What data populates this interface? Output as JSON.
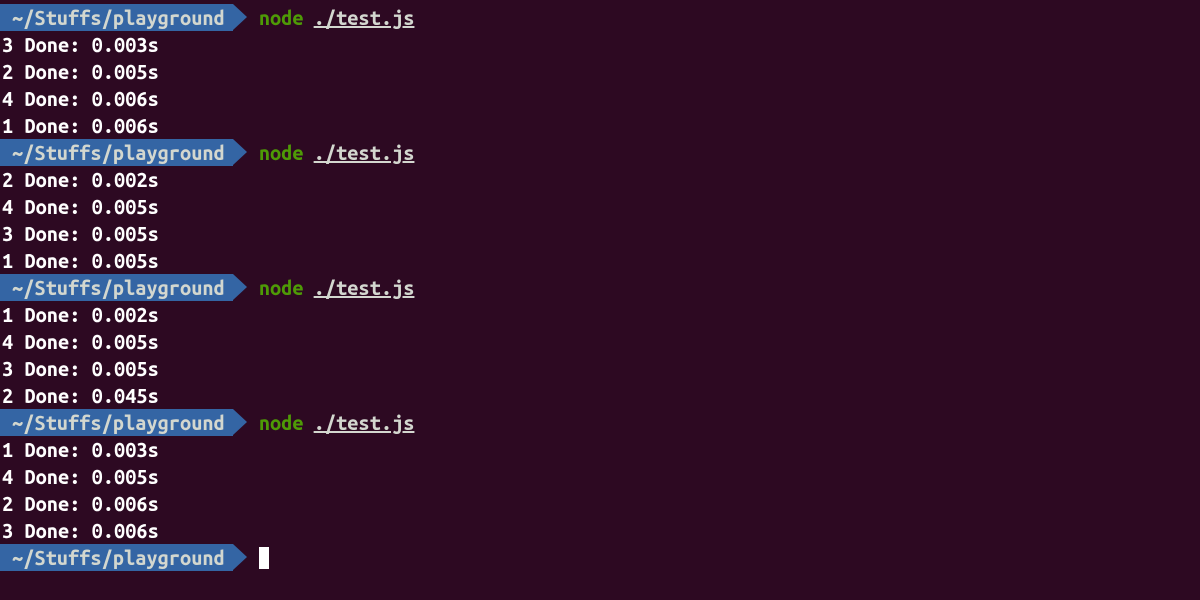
{
  "prompt_path": "~/Stuffs/playground",
  "command_executable": "node",
  "command_argument": "./test.js",
  "runs": [
    {
      "outputs": [
        "3 Done: 0.003s",
        "2 Done: 0.005s",
        "4 Done: 0.006s",
        "1 Done: 0.006s"
      ]
    },
    {
      "outputs": [
        "2 Done: 0.002s",
        "4 Done: 0.005s",
        "3 Done: 0.005s",
        "1 Done: 0.005s"
      ]
    },
    {
      "outputs": [
        "1 Done: 0.002s",
        "4 Done: 0.005s",
        "3 Done: 0.005s",
        "2 Done: 0.045s"
      ]
    },
    {
      "outputs": [
        "1 Done: 0.003s",
        "4 Done: 0.005s",
        "2 Done: 0.006s",
        "3 Done: 0.006s"
      ]
    }
  ]
}
